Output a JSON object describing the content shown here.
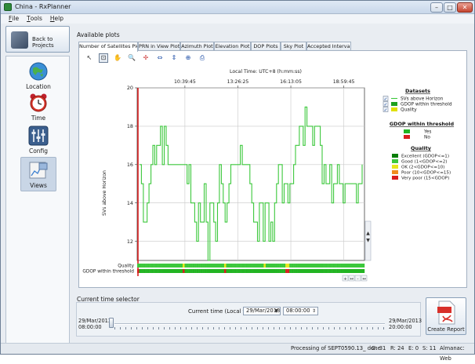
{
  "window": {
    "title": "China - RxPlanner"
  },
  "menu": [
    {
      "key": "F",
      "rest": "ile"
    },
    {
      "key": "T",
      "rest": "ools"
    },
    {
      "key": "H",
      "rest": "elp"
    }
  ],
  "sidebar": {
    "back_label": "Back to Projects",
    "items": [
      {
        "label": "Location",
        "icon": "globe-icon"
      },
      {
        "label": "Time",
        "icon": "alarm-clock-icon"
      },
      {
        "label": "Config",
        "icon": "sliders-icon"
      },
      {
        "label": "Views",
        "icon": "views-icon"
      }
    ],
    "active": "Views"
  },
  "main": {
    "available_label": "Available plots",
    "tabs": [
      "Number of Satellites Plot",
      "PRN in View Plot",
      "Azimuth Plot",
      "Elevation Plot",
      "DOP Plots",
      "Sky Plot",
      "Accepted Intervals"
    ],
    "active_tab": "Number of Satellites Plot",
    "toolbar": [
      "cursor-icon",
      "select-icon",
      "pan-hand-icon",
      "zoom-icon",
      "fit-all-icon",
      "zoom-h-icon",
      "zoom-v-icon",
      "crosshair-icon",
      "print-icon"
    ]
  },
  "chart_data": {
    "type": "line",
    "top_axis_label": "Local Time: UTC+8 (h:mm:ss)",
    "top_ticks": [
      "10:39:45",
      "13:26:25",
      "16:13:05",
      "18:59:45"
    ],
    "ylabel": "SVs above Horizon",
    "ylim": [
      11,
      20
    ],
    "yticks": [
      12,
      14,
      16,
      18,
      20
    ],
    "grid": true,
    "series": [
      {
        "name": "SVs above Horizon",
        "color": "#3cc83c",
        "values": [
          16,
          15,
          13,
          13,
          14,
          15,
          16,
          17,
          16,
          17,
          17,
          18,
          16,
          18,
          17,
          16,
          16,
          16,
          16,
          16,
          16,
          16,
          16,
          16,
          16,
          15,
          16,
          14,
          14,
          13,
          12,
          14,
          13,
          13,
          15,
          13,
          11,
          14,
          14,
          13,
          12,
          14,
          16,
          15,
          14,
          13,
          14,
          15,
          16,
          16,
          16,
          16,
          16,
          17,
          16,
          16,
          16,
          16,
          15,
          14,
          13,
          13,
          12,
          14,
          14,
          12,
          14,
          14,
          12,
          13,
          12,
          14,
          15,
          16,
          16,
          14,
          15,
          15,
          14,
          15,
          15,
          16,
          17,
          17,
          18,
          18,
          17,
          19,
          18,
          18,
          18,
          17,
          18,
          18,
          18,
          17,
          15,
          16,
          15,
          15,
          16,
          14,
          15,
          15,
          16,
          15,
          15,
          14,
          15,
          15,
          15,
          15,
          15,
          15,
          14,
          15,
          15,
          16
        ]
      }
    ],
    "legend": {
      "datasets_title": "Datasets",
      "datasets": [
        {
          "label": "SVs above Horizon",
          "color": "#3cc83c"
        },
        {
          "label": "GDOP within threshold",
          "color": "#1fa01f"
        },
        {
          "label": "Quality",
          "color": "#e0e000"
        }
      ],
      "gdop_title": "GDOP within threshold",
      "gdop": [
        {
          "label": "Yes",
          "color": "#22b422"
        },
        {
          "label": "No",
          "color": "#d81e1e"
        }
      ],
      "quality_title": "Quality",
      "quality": [
        {
          "label": "Excellent (GDOP<=1)",
          "color": "#0a7d0a"
        },
        {
          "label": "Good (1<GDOP<=2)",
          "color": "#3cc83c"
        },
        {
          "label": "OK (2<GDOP<=10)",
          "color": "#e6e61e"
        },
        {
          "label": "Poor (10<GDOP<=15)",
          "color": "#f08c1e"
        },
        {
          "label": "Very poor (15<GDOP)",
          "color": "#d81e1e"
        }
      ]
    },
    "bar_labels": [
      "Quality",
      "GDOP within threshold"
    ],
    "quality_bar": "GGGGGGGGGGGGGGGGGGGGGGGYGGGGGGGGGGGGGGGGGGGGYGGGGGGGGGGGGGGGGGGGYGGGGGGGGGGYYGGGGGGGGGGGGGGGGGGGGGGGGGGGGGGGGGGGGGG",
    "gdop_bar": "RGGGGGGGGGGGGGGGGGGGGGGRGGGGGGGGGGGGGGGGGGGGRGGGGGGGGGGGGGGGGGGGGGGGGGGGGGGRRGGGGGGGGGGGGGGGGGGGGGGGGGGGGGGGGGGGGGG"
  },
  "time_selector": {
    "label": "Current time selector",
    "current_label": "Current time (Local time):",
    "date": "29/Mar/2013",
    "time": "08:00:00",
    "start_date": "29/Mar/2013",
    "start_time": "08:00:00",
    "end_date": "29/Mar/2013",
    "end_time": "20:00:00"
  },
  "report": {
    "label": "Create Report"
  },
  "status": {
    "processing": "Processing of SEPT0590.13_ done",
    "g": "G: 31",
    "r": "R: 24",
    "e": "E: 0",
    "s": "S: 11",
    "almanac": "Almanac: Web"
  }
}
